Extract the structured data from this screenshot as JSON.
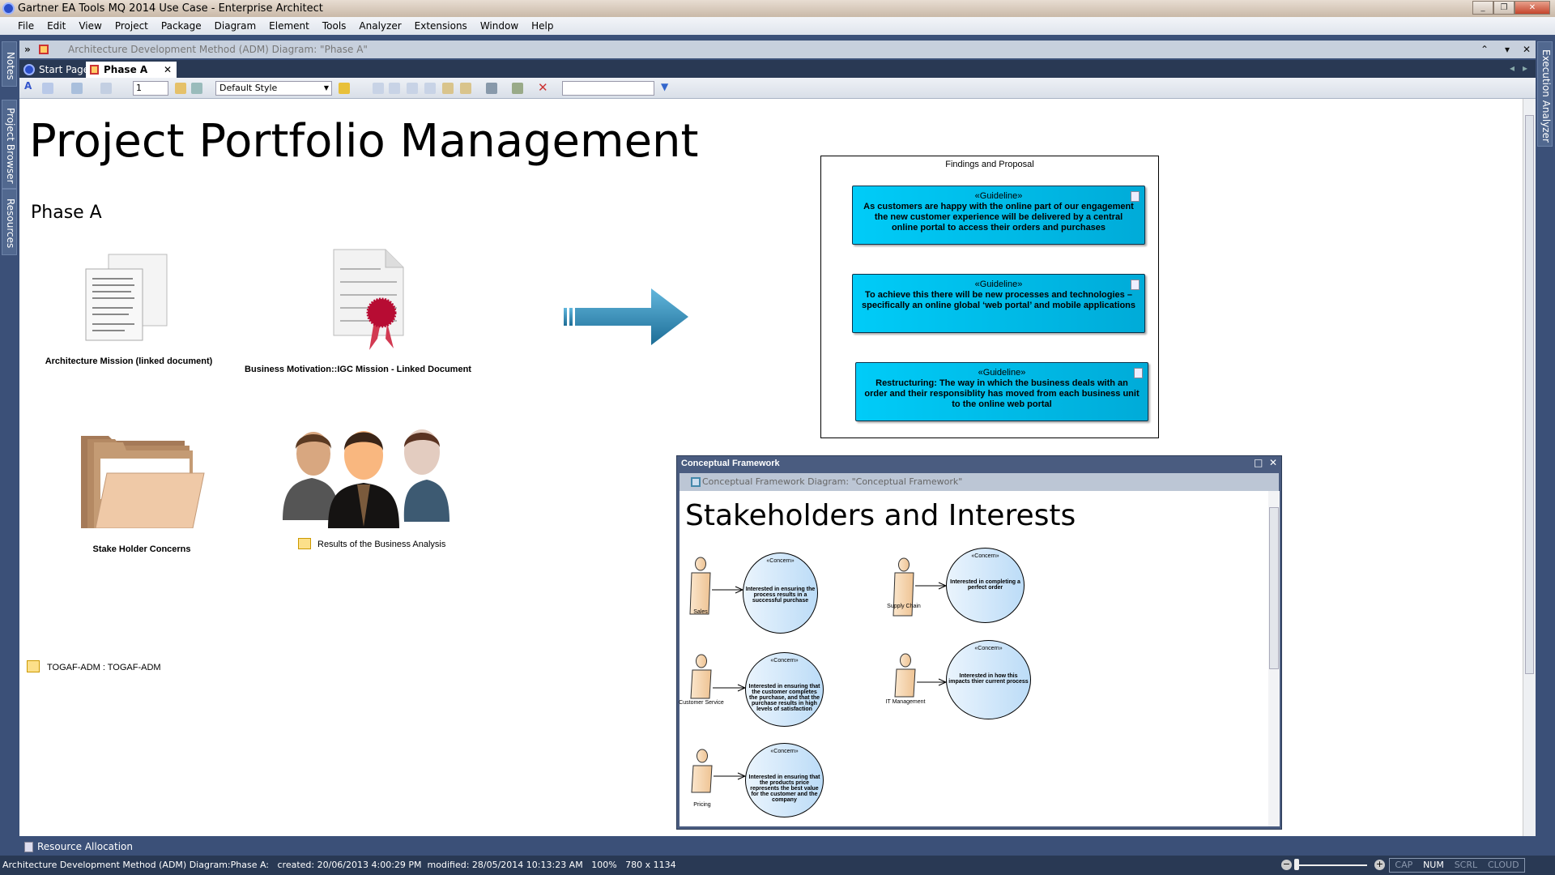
{
  "window": {
    "title": "Gartner EA Tools MQ 2014 Use Case - Enterprise Architect",
    "controls": [
      "minimize",
      "restore",
      "close"
    ]
  },
  "menu": [
    "File",
    "Edit",
    "View",
    "Project",
    "Package",
    "Diagram",
    "Element",
    "Tools",
    "Analyzer",
    "Extensions",
    "Window",
    "Help"
  ],
  "dock": {
    "left": [
      "Notes",
      "Project Browser",
      "Resources"
    ],
    "right": [
      "Execution Analyzer"
    ]
  },
  "breadcrumb": "Architecture Development Method (ADM) Diagram: \"Phase A\"",
  "tabs": [
    {
      "label": "Start Page",
      "active": false
    },
    {
      "label": "Phase A",
      "active": true
    }
  ],
  "toolbar": {
    "zoom_value": "1",
    "style": "Default Style",
    "search_value": ""
  },
  "diagram": {
    "title": "Project Portfolio Management",
    "subtitle": "Phase A",
    "elements": {
      "arch_mission": "Architecture Mission (linked document)",
      "business_motivation": "Business Motivation::IGC Mission - Linked Document",
      "stakeholder_concerns": "Stake Holder Concerns",
      "results": "Results of the Business Analysis",
      "togaf": "TOGAF-ADM : TOGAF-ADM"
    },
    "findings": {
      "title": "Findings and Proposal",
      "guidelines": [
        {
          "stereotype": "«Guideline»",
          "text": "As customers are happy with the online part of our engagement the new customer experience will be delivered by a central online portal to access their orders and purchases"
        },
        {
          "stereotype": "«Guideline»",
          "text": "To achieve this there will be new processes and technologies  – specifically an online global ‘web portal’ and mobile applications"
        },
        {
          "stereotype": "«Guideline»",
          "text": "Restructuring: The way in which the business deals with an order and their responsiblity has moved from each business unit to the online web portal"
        }
      ]
    }
  },
  "conceptual": {
    "window_title": "Conceptual Framework",
    "breadcrumb": "Conceptual Framework Diagram: \"Conceptual Framework\"",
    "title": "Stakeholders and Interests",
    "stakeholders": [
      {
        "actor": "Sales",
        "stereotype": "«Concern»",
        "concern": "Interested in ensuring the process results in a successful purchase"
      },
      {
        "actor": "Supply Chain",
        "stereotype": "«Concern»",
        "concern": "Interested in completing a perfect order"
      },
      {
        "actor": "Customer Service",
        "stereotype": "«Concern»",
        "concern": "Interested in ensuring that the customer completes the purchase, and that the purchase results in high levels of satisfaction"
      },
      {
        "actor": "IT Management",
        "stereotype": "«Concern»",
        "concern": "Interested in how this impacts thier current process"
      },
      {
        "actor": "Pricing",
        "stereotype": "«Concern»",
        "concern": "Interested in ensuring that the products price represents the best value for the customer and the company"
      }
    ]
  },
  "bottom_tab": "Resource Allocation",
  "status": {
    "text": "Architecture Development Method (ADM) Diagram:Phase A:   created: 20/06/2013 4:00:29 PM  modified: 28/05/2014 10:13:23 AM   100%   780 x 1134",
    "indicators": [
      "CAP",
      "NUM",
      "SCRL",
      "CLOUD"
    ],
    "active_indicator": "NUM"
  },
  "colors": {
    "guideline": "#00c0ea",
    "concern": "#cfe6fa",
    "actor": "#f2d2a8",
    "chrome": "#3b5078",
    "statusbar": "#293954"
  }
}
